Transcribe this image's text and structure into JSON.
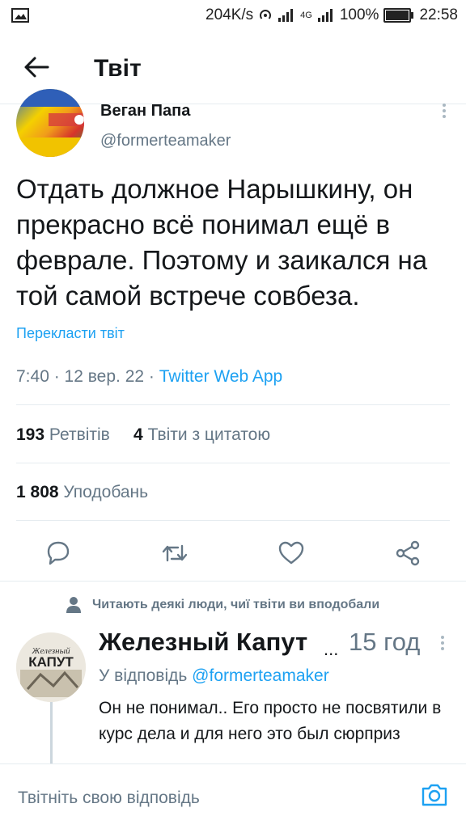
{
  "status_bar": {
    "speed": "204K/s",
    "network": "4G",
    "battery": "100%",
    "time": "22:58"
  },
  "header": {
    "title": "Твіт"
  },
  "tweet": {
    "author_name": "Веган Папа",
    "author_handle": "@formerteamaker",
    "text": "Отдать должное Нарышкину, он прекрасно всё понимал ещё в феврале. Поэтому и заикался на той самой встрече совбеза.",
    "translate_label": "Перекласти твіт",
    "time": "7:40",
    "date": "12 вер. 22",
    "source": "Twitter Web App",
    "retweets_count": "193",
    "retweets_label": "Ретвітів",
    "quotes_count": "4",
    "quotes_label": "Твіти з цитатою",
    "likes_count": "1 808",
    "likes_label": "Уподобань"
  },
  "reply": {
    "social_context": "Читають деякі люди, чиї твіти ви вподобали",
    "author_name": "Железный Капут",
    "ellipsis": "...",
    "time_ago": "15 год",
    "replying_to_label": "У відповідь",
    "replying_to_handle": "@formerteamaker",
    "text": "Он не понимал.. Его просто не посвятили в курс дела и для него это был сюрприз"
  },
  "avatar_logo_text": [
    "Железный",
    "КАПУТ"
  ],
  "compose": {
    "placeholder": "Твітніть свою відповідь"
  },
  "colors": {
    "accent": "#1da1f2",
    "secondary_text": "#657786",
    "primary_text": "#14171a",
    "divider": "#e6ecf0"
  },
  "icons": [
    "image-icon",
    "hotspot-icon",
    "signal-icon",
    "battery-icon",
    "back-arrow-icon",
    "more-vertical-icon",
    "reply-icon",
    "retweet-icon",
    "like-icon",
    "share-icon",
    "person-icon",
    "camera-icon"
  ]
}
